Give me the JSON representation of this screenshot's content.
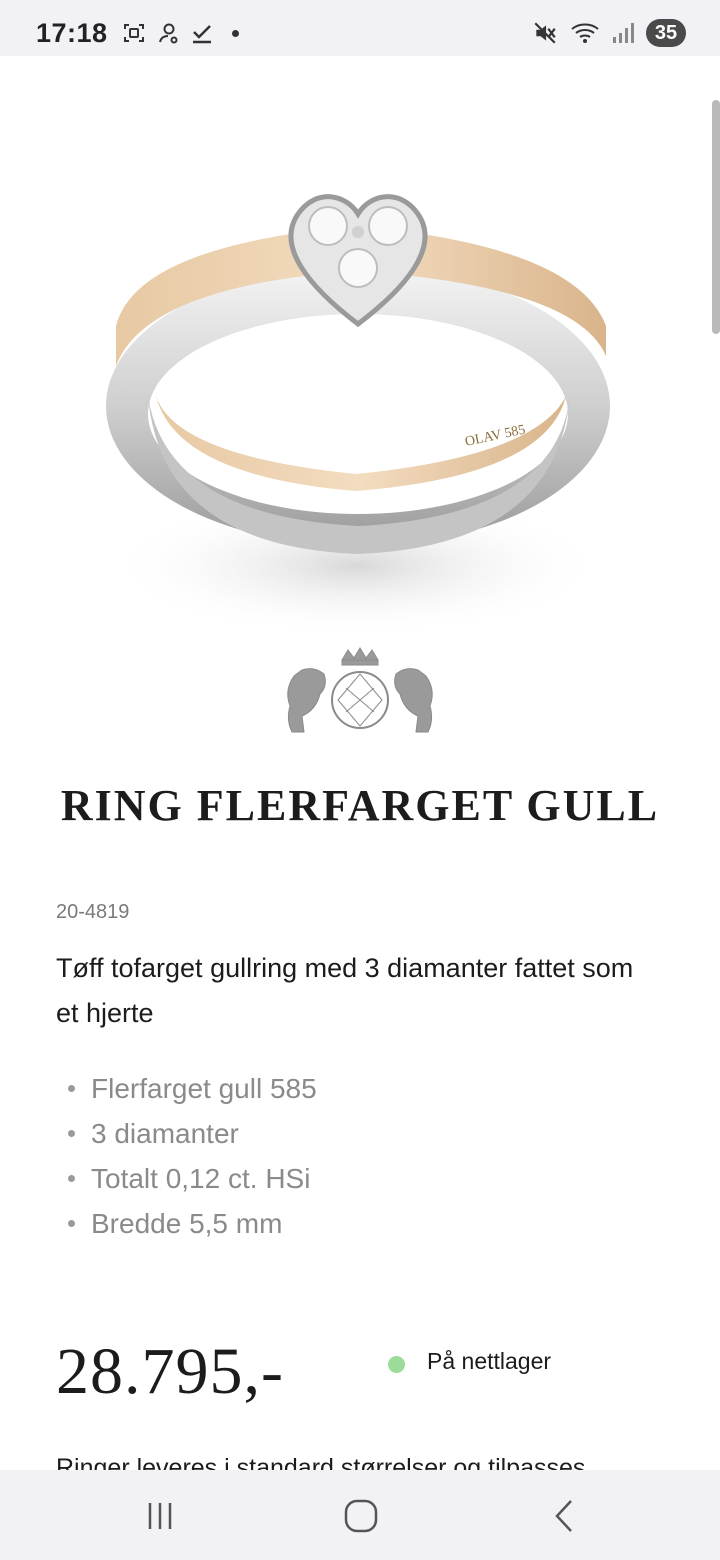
{
  "status_bar": {
    "time": "17:18",
    "left_icons": [
      "screenshot-icon",
      "contact-icon",
      "checkmark-icon",
      "notification-dot"
    ],
    "right_icons": [
      "mute-icon",
      "wifi-icon",
      "signal-icon"
    ],
    "battery": "35"
  },
  "product": {
    "title": "RING FLERFARGET GULL",
    "sku": "20-4819",
    "description": "Tøff tofarget gullring med 3 diamanter fattet som et hjerte",
    "specs": [
      "Flerfarget gull 585",
      "3 diamanter",
      "Totalt 0,12 ct. HSi",
      "Bredde 5,5 mm"
    ],
    "price": "28.795,-",
    "stock_status": "På nettlager",
    "stock_color": "#9bdc9b",
    "note_partial": "Ringer leveres i standard størrelser og tilpasses"
  },
  "nav_bar": {
    "buttons": [
      "recent-apps",
      "home",
      "back"
    ]
  }
}
